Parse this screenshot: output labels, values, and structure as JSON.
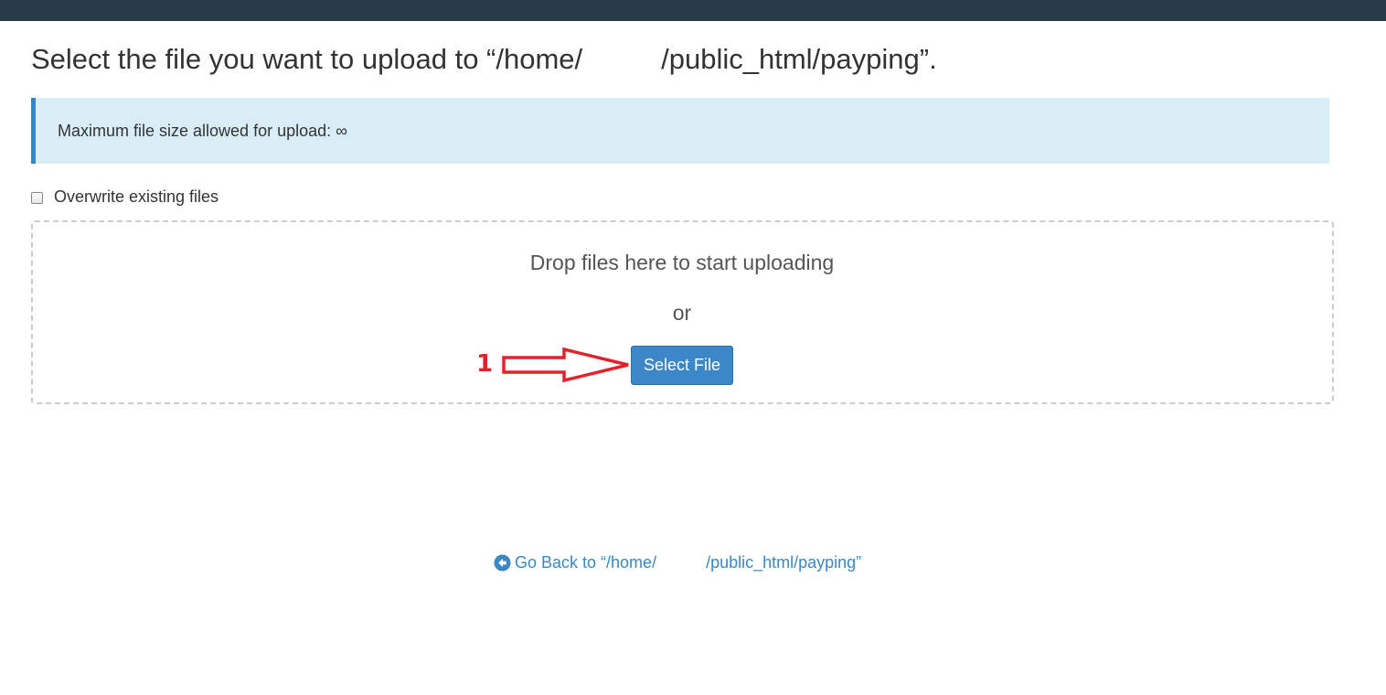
{
  "title": {
    "prefix": "Select the file you want to upload to “/home/",
    "suffix": "/public_html/payping”."
  },
  "info": {
    "label": "Maximum file size allowed for upload: ∞"
  },
  "overwrite": {
    "label": "Overwrite existing files",
    "checked": false
  },
  "dropzone": {
    "drop_text": "Drop files here to start uploading",
    "or_text": "or",
    "select_button": "Select File"
  },
  "annotation": {
    "number": "1",
    "color": "#e3222b"
  },
  "back_link": {
    "prefix": "Go Back to “/home/",
    "suffix": "/public_html/payping”",
    "icon": "arrow-circle-left-icon"
  },
  "colors": {
    "topbar": "#293a4a",
    "info_bg": "#d9edf7",
    "info_border": "#3a87c4",
    "button": "#3c87c8",
    "link": "#3a87c4"
  }
}
